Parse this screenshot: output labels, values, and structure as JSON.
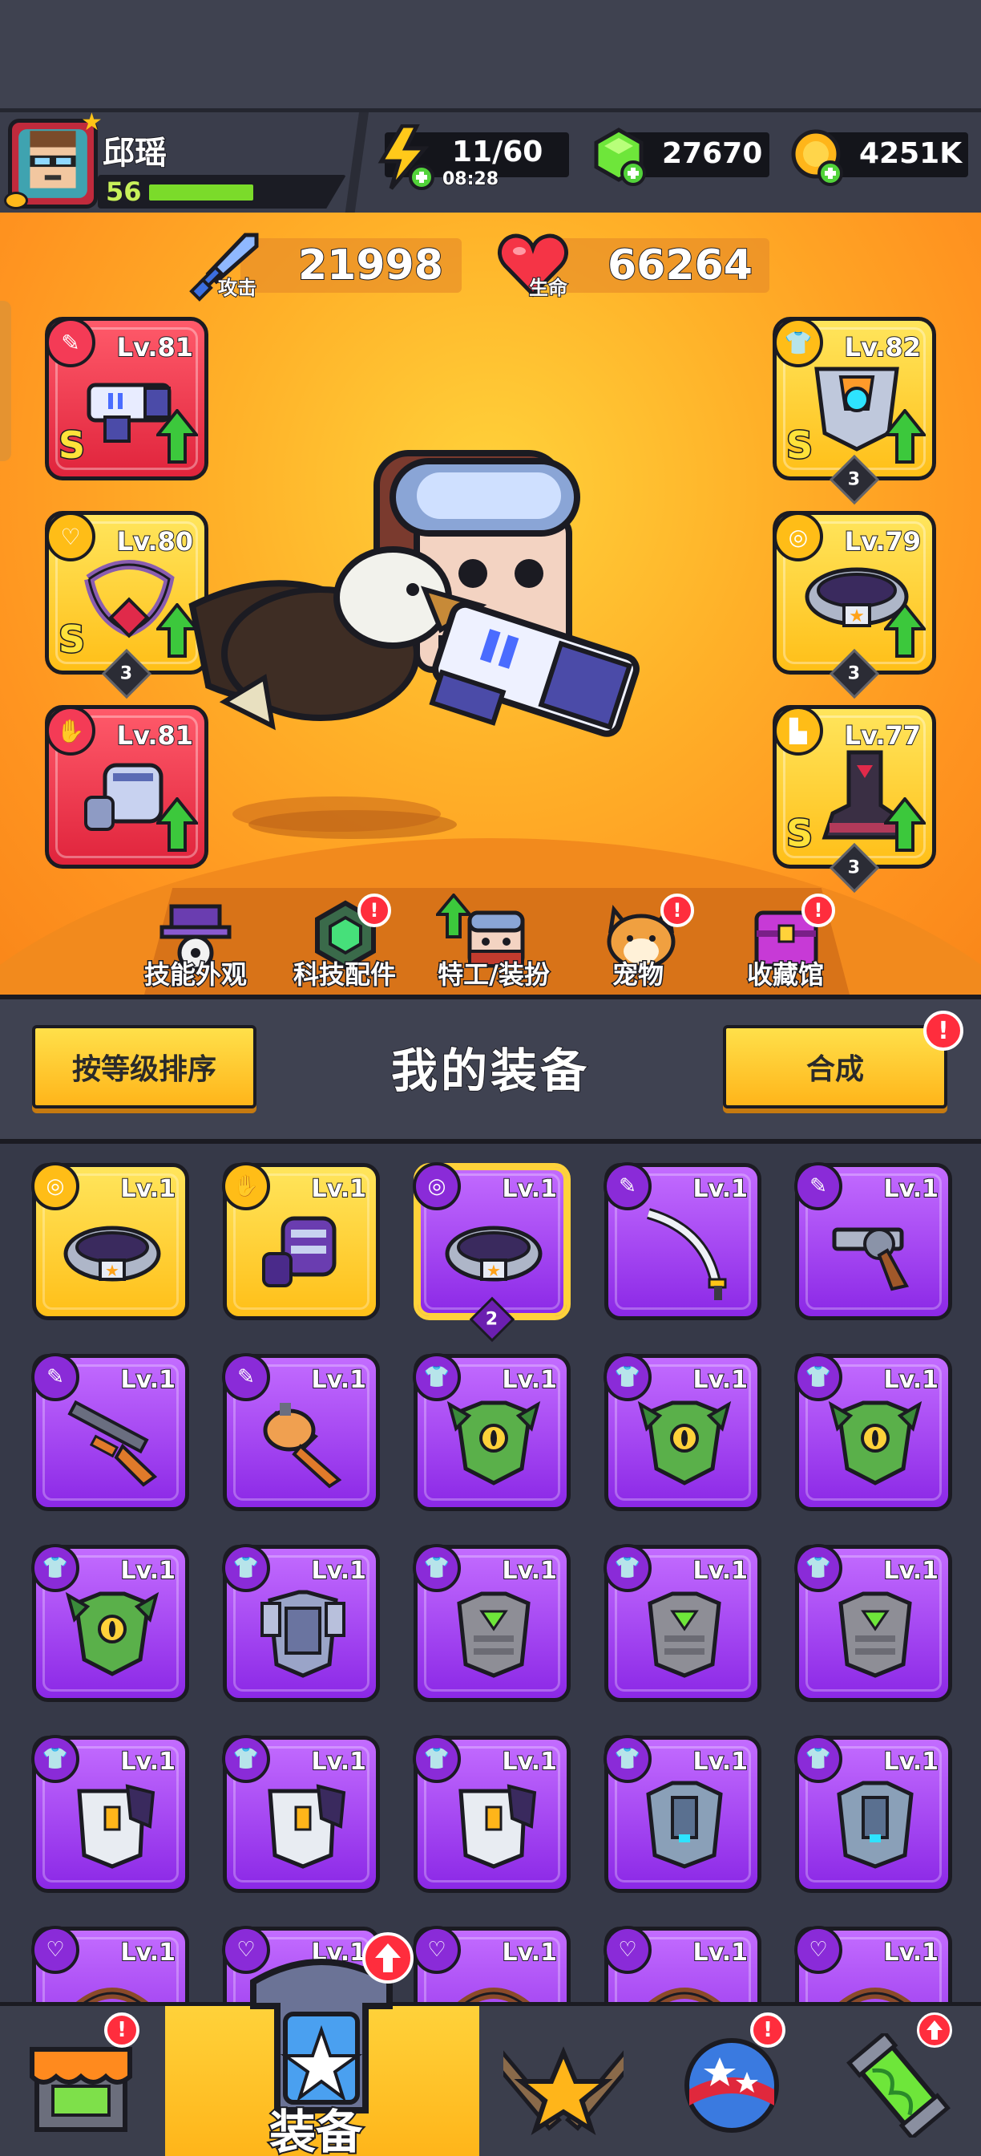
{
  "player": {
    "name": "邱瑶",
    "level": "56",
    "xp_fraction": 0.62
  },
  "resources": {
    "energy": "11/60",
    "energy_timer": "08:28",
    "gems": "27670",
    "coins": "4251K"
  },
  "stats": {
    "attack_label": "攻击",
    "attack_value": "21998",
    "hp_label": "生命",
    "hp_value": "66264"
  },
  "equipped": {
    "left": [
      {
        "slot": "weapon",
        "level": "Lv.81",
        "rank": "S",
        "rarity": "red",
        "stars": null,
        "can_upgrade": true
      },
      {
        "slot": "necklace",
        "level": "Lv.80",
        "rank": "S",
        "rarity": "yellow",
        "stars": "3",
        "can_upgrade": true
      },
      {
        "slot": "gloves",
        "level": "Lv.81",
        "rank": null,
        "rarity": "red",
        "stars": null,
        "can_upgrade": true
      }
    ],
    "right": [
      {
        "slot": "armor",
        "level": "Lv.82",
        "rank": "S",
        "rarity": "yellow",
        "stars": "3",
        "can_upgrade": true
      },
      {
        "slot": "belt",
        "level": "Lv.79",
        "rank": null,
        "rarity": "yellow",
        "stars": "3",
        "can_upgrade": true
      },
      {
        "slot": "boots",
        "level": "Lv.77",
        "rank": "S",
        "rarity": "yellow",
        "stars": "3",
        "can_upgrade": true
      }
    ]
  },
  "menu": [
    {
      "label": "技能外观",
      "badge": false
    },
    {
      "label": "科技配件",
      "badge": true
    },
    {
      "label": "特工/装扮",
      "badge": false,
      "up": true
    },
    {
      "label": "宠物",
      "badge": true
    },
    {
      "label": "收藏馆",
      "badge": true
    }
  ],
  "inventory": {
    "sort_button": "按等级排序",
    "title": "我的装备",
    "merge_button": "合成",
    "merge_badge": "!",
    "items": [
      {
        "type": "belt",
        "rarity": "yellow",
        "level": "Lv.1"
      },
      {
        "type": "gloves",
        "rarity": "yellow",
        "level": "Lv.1"
      },
      {
        "type": "belt",
        "rarity": "purple",
        "level": "Lv.1",
        "stars": "2",
        "selected": true
      },
      {
        "type": "sword",
        "rarity": "purple",
        "level": "Lv.1"
      },
      {
        "type": "revolver",
        "rarity": "purple",
        "level": "Lv.1"
      },
      {
        "type": "shotgun",
        "rarity": "purple",
        "level": "Lv.1"
      },
      {
        "type": "drill",
        "rarity": "purple",
        "level": "Lv.1"
      },
      {
        "type": "dragon-armor",
        "rarity": "purple",
        "level": "Lv.1"
      },
      {
        "type": "dragon-armor",
        "rarity": "purple",
        "level": "Lv.1"
      },
      {
        "type": "dragon-armor",
        "rarity": "purple",
        "level": "Lv.1"
      },
      {
        "type": "dragon-armor",
        "rarity": "purple",
        "level": "Lv.1"
      },
      {
        "type": "steel-armor",
        "rarity": "purple",
        "level": "Lv.1"
      },
      {
        "type": "stone-armor",
        "rarity": "purple",
        "level": "Lv.1"
      },
      {
        "type": "stone-armor",
        "rarity": "purple",
        "level": "Lv.1"
      },
      {
        "type": "stone-armor",
        "rarity": "purple",
        "level": "Lv.1"
      },
      {
        "type": "white-armor",
        "rarity": "purple",
        "level": "Lv.1"
      },
      {
        "type": "white-armor",
        "rarity": "purple",
        "level": "Lv.1"
      },
      {
        "type": "white-armor",
        "rarity": "purple",
        "level": "Lv.1"
      },
      {
        "type": "knight-armor",
        "rarity": "purple",
        "level": "Lv.1"
      },
      {
        "type": "knight-armor",
        "rarity": "purple",
        "level": "Lv.1"
      },
      {
        "type": "necklace",
        "rarity": "purple",
        "level": "Lv.1"
      },
      {
        "type": "necklace",
        "rarity": "purple",
        "level": "Lv.1"
      },
      {
        "type": "necklace",
        "rarity": "purple",
        "level": "Lv.1"
      },
      {
        "type": "necklace",
        "rarity": "purple",
        "level": "Lv.1"
      },
      {
        "type": "necklace",
        "rarity": "purple",
        "level": "Lv.1"
      }
    ]
  },
  "bottom_nav": [
    {
      "name": "shop",
      "label": "",
      "badge": "!"
    },
    {
      "name": "equipment",
      "label": "装备",
      "active": true,
      "badge": "up"
    },
    {
      "name": "battle",
      "label": ""
    },
    {
      "name": "world",
      "label": "",
      "badge": "!"
    },
    {
      "name": "lab",
      "label": "",
      "badge": "up"
    }
  ],
  "colors": {
    "red_rarity": "#e0243c",
    "yellow_rarity": "#ffbf18",
    "purple_rarity": "#8b28e6",
    "upgrade_arrow": "#3cc83c",
    "accent": "#ffd23a"
  }
}
